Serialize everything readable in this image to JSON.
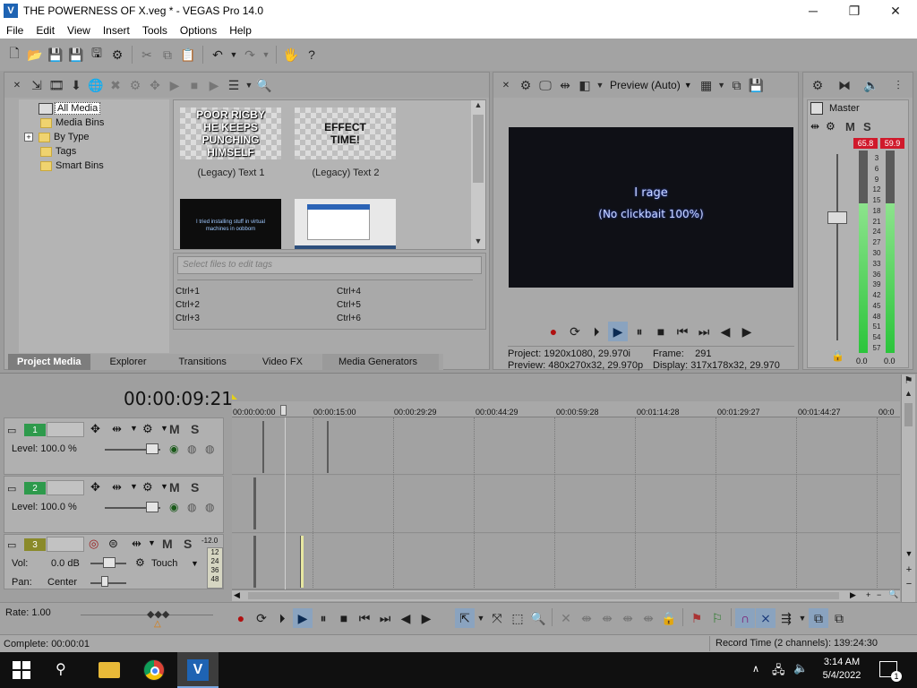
{
  "window": {
    "title": "THE POWERNESS OF X.veg * - VEGAS Pro 14.0",
    "logo": "V",
    "minimize_glyph": "─",
    "maximize_glyph": "❐",
    "close_glyph": "✕"
  },
  "menu": [
    "File",
    "Edit",
    "View",
    "Insert",
    "Tools",
    "Options",
    "Help"
  ],
  "project_media": {
    "tree": [
      {
        "label": "All Media",
        "selected": true,
        "expander": ""
      },
      {
        "label": "Media Bins",
        "selected": false,
        "expander": ""
      },
      {
        "label": "By Type",
        "selected": false,
        "expander": "+"
      },
      {
        "label": "Tags",
        "selected": false,
        "expander": ""
      },
      {
        "label": "Smart Bins",
        "selected": false,
        "expander": ""
      }
    ],
    "items": [
      {
        "thumb_text": "POOR RIGBY HE KEEPS PUNCHING HIMSELF",
        "label": "(Legacy) Text 1"
      },
      {
        "thumb_text": "EFFECT TIME!",
        "label": "(Legacy) Text 2"
      },
      {
        "thumb_text": "I tried installing stuff in virtual machines in oobbom"
      }
    ],
    "tags_placeholder": "Select files to edit tags",
    "shortcuts": [
      "Ctrl+1",
      "Ctrl+2",
      "Ctrl+3",
      "Ctrl+4",
      "Ctrl+5",
      "Ctrl+6"
    ]
  },
  "tabs": [
    "Project Media",
    "Explorer",
    "Transitions",
    "Video FX",
    "Media Generators"
  ],
  "preview": {
    "quality": "Preview (Auto)",
    "frame_text_line1": "I rage",
    "frame_text_line2": "(No clickbait 100%)",
    "project_label": "Project:",
    "project_value": "1920x1080, 29.970i",
    "preview_label": "Preview:",
    "preview_value": "480x270x32, 29.970p",
    "frame_label": "Frame:",
    "frame_value": "291",
    "display_label": "Display:",
    "display_value": "317x178x32, 29.970"
  },
  "master": {
    "label": "Master",
    "peak_left": "65.8",
    "peak_right": "59.9",
    "scale": [
      "3",
      "6",
      "9",
      "12",
      "15",
      "18",
      "21",
      "24",
      "27",
      "30",
      "33",
      "36",
      "39",
      "42",
      "45",
      "48",
      "51",
      "54",
      "57"
    ],
    "bottom_left": "0.0",
    "bottom_right": "0.0",
    "m_label": "M",
    "s_label": "S",
    "level_left": 0.74,
    "level_right": 0.74
  },
  "timeline": {
    "timecode": "00:00:09:21",
    "ruler": [
      "00:00:00:00",
      "00:00:15:00",
      "00:00:29:29",
      "00:00:44:29",
      "00:00:59:28",
      "00:01:14:28",
      "00:01:29:27",
      "00:01:44:27",
      "00:0"
    ],
    "tracks": [
      {
        "num": "1",
        "level_label": "Level:",
        "level_value": "100.0 %",
        "color": "#2e9a4c"
      },
      {
        "num": "2",
        "level_label": "Level:",
        "level_value": "100.0 %",
        "color": "#2e9a4c"
      },
      {
        "num": "3",
        "vol_label": "Vol:",
        "vol_value": "0.0 dB",
        "pan_label": "Pan:",
        "pan_value": "Center",
        "touch": "Touch",
        "db": "-12.0",
        "meter": [
          "12",
          "24",
          "36",
          "48"
        ],
        "color": "#8a8a2a"
      }
    ],
    "m_label": "M",
    "s_label": "S",
    "rate_label": "Rate: 1.00"
  },
  "status": {
    "complete": "Complete: 00:00:01",
    "record_time": "Record Time (2 channels): 139:24:30"
  },
  "taskbar": {
    "time": "3:14 AM",
    "date": "5/4/2022",
    "notification_count": "1"
  }
}
